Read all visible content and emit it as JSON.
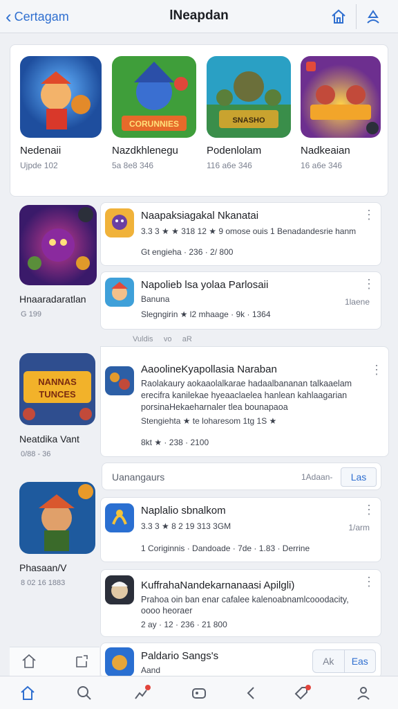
{
  "header": {
    "back_label": "Certagam",
    "title": "lNeapdan",
    "icons": [
      "home-icon",
      "user-icon"
    ]
  },
  "featured": [
    {
      "name": "Nedenaii",
      "meta": "Ujpde 102",
      "theme": {
        "bg": "#1e6ac9",
        "fg": "#f39a2c"
      }
    },
    {
      "name": "Nazdkhlenegu",
      "meta": "5a 8e8 346",
      "theme": {
        "bg": "#3f9e3a",
        "fg": "#e66a2a"
      }
    },
    {
      "name": "Podenlolam",
      "meta": "116 a6e 346",
      "theme": {
        "bg": "#2aa0c4",
        "fg": "#c9a32f"
      }
    },
    {
      "name": "Nadkeaian",
      "meta": "16 a6e 346",
      "theme": {
        "bg": "#6d2f8f",
        "fg": "#f2a52a"
      }
    }
  ],
  "left_items": [
    {
      "name": "Hnaaradaratlan",
      "meta": "G 199",
      "theme": {
        "bg": "#7a2fb8",
        "fg": "#c23b8e"
      }
    },
    {
      "name": "Neatdika Vant",
      "meta": "0/88 - 36",
      "theme": {
        "bg": "#2f4e8f",
        "fg": "#f2b22a"
      }
    },
    {
      "name": "Phasaan/V",
      "meta": "8 02 16 1883",
      "theme": {
        "bg": "#1e5a9e",
        "fg": "#d9582e"
      }
    }
  ],
  "section_tabs": [
    "Vuldis",
    "vo",
    "aR"
  ],
  "list_items": [
    {
      "title": "Naapaksiagakal Nkanatai",
      "line1": "3.3 3 ★ ★ 318 12 ★ 9 omose ouis 1 Benadandesrie hanm",
      "line2": "Gt engieha · 236 · 2/ 800",
      "right": "",
      "icon_theme": {
        "bg": "#f0b23a",
        "fg": "#6a3fa3"
      }
    },
    {
      "title": "Napolieb lsa yolaa Parlosaii",
      "line1": "Banuna",
      "line2": "Slegngirin ★ l2 mhaage · 9k · 1364",
      "right": "1laene",
      "icon_theme": {
        "bg": "#e24a3a",
        "fg": "#3fa0d9"
      }
    },
    {
      "title": "AaoolineKyapollasia Naraban",
      "body": [
        "Raolakaury aokaaolalkarae hadaalbananan talkaaelam",
        "erecifra kanilekae hyeaaclaelea hanlean kahlaagarian",
        "porsinaHekaeharnaler tlea bounapaoa"
      ],
      "line1": "Stengiehta ★ te loharesom 1tg   1S ★",
      "line2": "8kt   ★ · 238 · 2100",
      "right": "",
      "icon_theme": {
        "bg": "#2c5fa6",
        "fg": "#e39a2c"
      }
    },
    {
      "title": "Naplalio sbnalkom",
      "line1": "3.3 3 ★ 8 2 19 313  3GM",
      "line2": "1 Coriginnis · Dandoade · 7de · 1.83 · Derrine",
      "right": "1/arm",
      "icon_theme": {
        "bg": "#2a6fd1",
        "fg": "#f2c23a"
      }
    },
    {
      "title": "KuffrahaNandekarnanaasi Apilgli)",
      "body": [
        "Prahoa oin ban enar cafalee kalenoabnamlcooodacity,",
        "oooo heoraer"
      ],
      "line2": "2 ay · 12 · 236 · 21 800",
      "right": "",
      "icon_theme": {
        "bg": "#2b2f3a",
        "fg": "#e1c9a6"
      }
    },
    {
      "title": "Paldario Sangs's",
      "line1": "Aand",
      "right": "",
      "icon_theme": {
        "bg": "#2a6fd1",
        "fg": "#e7a63a"
      }
    }
  ],
  "filter": {
    "label": "Uanangaurs",
    "count": "1Adaan-",
    "button": "Las"
  },
  "pill": {
    "left": "Ak",
    "right": "Eas"
  },
  "bottom_nav": [
    "home-icon",
    "search-icon",
    "activity-icon",
    "games-icon",
    "back-icon",
    "tag-icon",
    "profile-icon"
  ],
  "colors": {
    "accent": "#2f6fd0",
    "star": "#9bb43a",
    "coin": "#e9b82a",
    "badge": "#e2453c"
  }
}
